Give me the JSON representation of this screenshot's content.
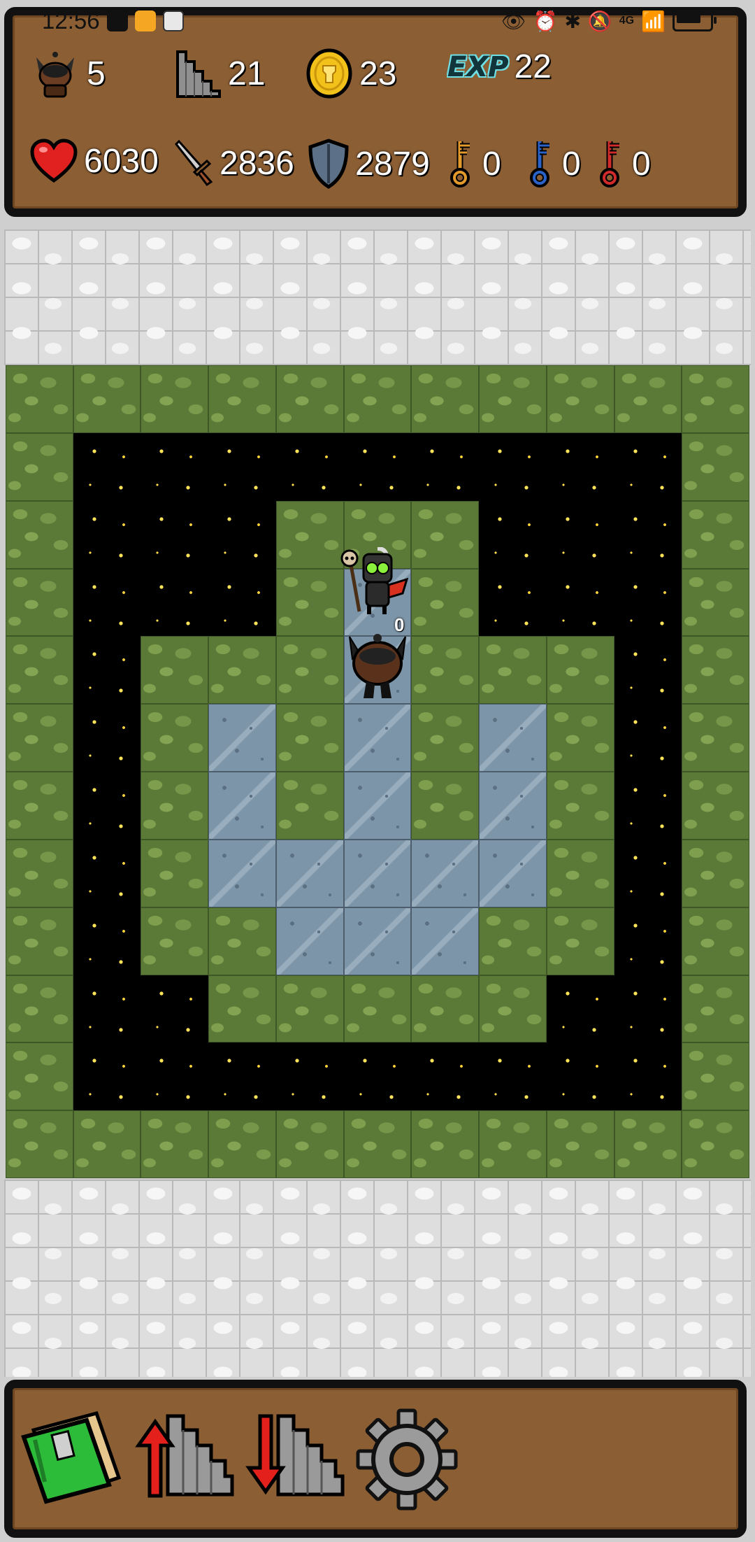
{
  "status_bar": {
    "time": "12:56",
    "network": "4G"
  },
  "hud": {
    "level": "5",
    "floor": "21",
    "gold": "23",
    "exp_label": "EXP",
    "exp": "22",
    "hp": "6030",
    "attack": "2836",
    "defense": "2879",
    "yellow_keys": "0",
    "blue_keys": "0",
    "red_keys": "0"
  },
  "map": {
    "rows": [
      "WWWWWWWWWWW",
      "WSSSSSSSSSW",
      "WSSSWWWSSSW",
      "WSSSWFWSSSW",
      "WSWWWFWWWSW",
      "WSWFWFWFWSW",
      "WSWFWFWFWSW",
      "WSWFFFFFWSW",
      "WSWWFFFWWSW",
      "WSSWWWWWSSW",
      "WSSSSSSSSSW",
      "WWWWWWWWWWW"
    ],
    "monster_damage_label": "0"
  },
  "toolbar": {
    "book": "monster-manual",
    "up": "floor-up",
    "down": "floor-down",
    "settings": "settings"
  },
  "colors": {
    "panel": "#8b5e33",
    "wall": "#5b7a37",
    "floor": "#7d95a8",
    "star": "#ffe45a"
  }
}
